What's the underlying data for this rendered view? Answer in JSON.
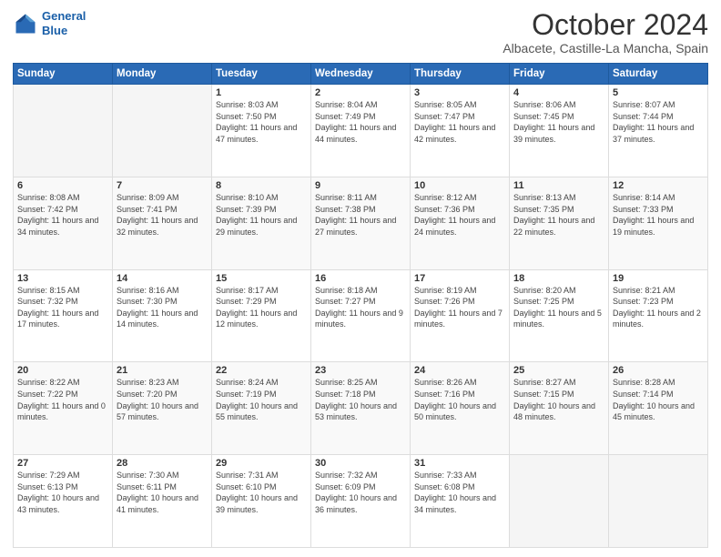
{
  "logo": {
    "line1": "General",
    "line2": "Blue"
  },
  "header": {
    "month": "October 2024",
    "location": "Albacete, Castille-La Mancha, Spain"
  },
  "columns": [
    "Sunday",
    "Monday",
    "Tuesday",
    "Wednesday",
    "Thursday",
    "Friday",
    "Saturday"
  ],
  "weeks": [
    [
      {
        "day": "",
        "sunrise": "",
        "sunset": "",
        "daylight": "",
        "empty": true
      },
      {
        "day": "",
        "sunrise": "",
        "sunset": "",
        "daylight": "",
        "empty": true
      },
      {
        "day": "1",
        "sunrise": "Sunrise: 8:03 AM",
        "sunset": "Sunset: 7:50 PM",
        "daylight": "Daylight: 11 hours and 47 minutes."
      },
      {
        "day": "2",
        "sunrise": "Sunrise: 8:04 AM",
        "sunset": "Sunset: 7:49 PM",
        "daylight": "Daylight: 11 hours and 44 minutes."
      },
      {
        "day": "3",
        "sunrise": "Sunrise: 8:05 AM",
        "sunset": "Sunset: 7:47 PM",
        "daylight": "Daylight: 11 hours and 42 minutes."
      },
      {
        "day": "4",
        "sunrise": "Sunrise: 8:06 AM",
        "sunset": "Sunset: 7:45 PM",
        "daylight": "Daylight: 11 hours and 39 minutes."
      },
      {
        "day": "5",
        "sunrise": "Sunrise: 8:07 AM",
        "sunset": "Sunset: 7:44 PM",
        "daylight": "Daylight: 11 hours and 37 minutes."
      }
    ],
    [
      {
        "day": "6",
        "sunrise": "Sunrise: 8:08 AM",
        "sunset": "Sunset: 7:42 PM",
        "daylight": "Daylight: 11 hours and 34 minutes."
      },
      {
        "day": "7",
        "sunrise": "Sunrise: 8:09 AM",
        "sunset": "Sunset: 7:41 PM",
        "daylight": "Daylight: 11 hours and 32 minutes."
      },
      {
        "day": "8",
        "sunrise": "Sunrise: 8:10 AM",
        "sunset": "Sunset: 7:39 PM",
        "daylight": "Daylight: 11 hours and 29 minutes."
      },
      {
        "day": "9",
        "sunrise": "Sunrise: 8:11 AM",
        "sunset": "Sunset: 7:38 PM",
        "daylight": "Daylight: 11 hours and 27 minutes."
      },
      {
        "day": "10",
        "sunrise": "Sunrise: 8:12 AM",
        "sunset": "Sunset: 7:36 PM",
        "daylight": "Daylight: 11 hours and 24 minutes."
      },
      {
        "day": "11",
        "sunrise": "Sunrise: 8:13 AM",
        "sunset": "Sunset: 7:35 PM",
        "daylight": "Daylight: 11 hours and 22 minutes."
      },
      {
        "day": "12",
        "sunrise": "Sunrise: 8:14 AM",
        "sunset": "Sunset: 7:33 PM",
        "daylight": "Daylight: 11 hours and 19 minutes."
      }
    ],
    [
      {
        "day": "13",
        "sunrise": "Sunrise: 8:15 AM",
        "sunset": "Sunset: 7:32 PM",
        "daylight": "Daylight: 11 hours and 17 minutes."
      },
      {
        "day": "14",
        "sunrise": "Sunrise: 8:16 AM",
        "sunset": "Sunset: 7:30 PM",
        "daylight": "Daylight: 11 hours and 14 minutes."
      },
      {
        "day": "15",
        "sunrise": "Sunrise: 8:17 AM",
        "sunset": "Sunset: 7:29 PM",
        "daylight": "Daylight: 11 hours and 12 minutes."
      },
      {
        "day": "16",
        "sunrise": "Sunrise: 8:18 AM",
        "sunset": "Sunset: 7:27 PM",
        "daylight": "Daylight: 11 hours and 9 minutes."
      },
      {
        "day": "17",
        "sunrise": "Sunrise: 8:19 AM",
        "sunset": "Sunset: 7:26 PM",
        "daylight": "Daylight: 11 hours and 7 minutes."
      },
      {
        "day": "18",
        "sunrise": "Sunrise: 8:20 AM",
        "sunset": "Sunset: 7:25 PM",
        "daylight": "Daylight: 11 hours and 5 minutes."
      },
      {
        "day": "19",
        "sunrise": "Sunrise: 8:21 AM",
        "sunset": "Sunset: 7:23 PM",
        "daylight": "Daylight: 11 hours and 2 minutes."
      }
    ],
    [
      {
        "day": "20",
        "sunrise": "Sunrise: 8:22 AM",
        "sunset": "Sunset: 7:22 PM",
        "daylight": "Daylight: 11 hours and 0 minutes."
      },
      {
        "day": "21",
        "sunrise": "Sunrise: 8:23 AM",
        "sunset": "Sunset: 7:20 PM",
        "daylight": "Daylight: 10 hours and 57 minutes."
      },
      {
        "day": "22",
        "sunrise": "Sunrise: 8:24 AM",
        "sunset": "Sunset: 7:19 PM",
        "daylight": "Daylight: 10 hours and 55 minutes."
      },
      {
        "day": "23",
        "sunrise": "Sunrise: 8:25 AM",
        "sunset": "Sunset: 7:18 PM",
        "daylight": "Daylight: 10 hours and 53 minutes."
      },
      {
        "day": "24",
        "sunrise": "Sunrise: 8:26 AM",
        "sunset": "Sunset: 7:16 PM",
        "daylight": "Daylight: 10 hours and 50 minutes."
      },
      {
        "day": "25",
        "sunrise": "Sunrise: 8:27 AM",
        "sunset": "Sunset: 7:15 PM",
        "daylight": "Daylight: 10 hours and 48 minutes."
      },
      {
        "day": "26",
        "sunrise": "Sunrise: 8:28 AM",
        "sunset": "Sunset: 7:14 PM",
        "daylight": "Daylight: 10 hours and 45 minutes."
      }
    ],
    [
      {
        "day": "27",
        "sunrise": "Sunrise: 7:29 AM",
        "sunset": "Sunset: 6:13 PM",
        "daylight": "Daylight: 10 hours and 43 minutes."
      },
      {
        "day": "28",
        "sunrise": "Sunrise: 7:30 AM",
        "sunset": "Sunset: 6:11 PM",
        "daylight": "Daylight: 10 hours and 41 minutes."
      },
      {
        "day": "29",
        "sunrise": "Sunrise: 7:31 AM",
        "sunset": "Sunset: 6:10 PM",
        "daylight": "Daylight: 10 hours and 39 minutes."
      },
      {
        "day": "30",
        "sunrise": "Sunrise: 7:32 AM",
        "sunset": "Sunset: 6:09 PM",
        "daylight": "Daylight: 10 hours and 36 minutes."
      },
      {
        "day": "31",
        "sunrise": "Sunrise: 7:33 AM",
        "sunset": "Sunset: 6:08 PM",
        "daylight": "Daylight: 10 hours and 34 minutes."
      },
      {
        "day": "",
        "sunrise": "",
        "sunset": "",
        "daylight": "",
        "empty": true
      },
      {
        "day": "",
        "sunrise": "",
        "sunset": "",
        "daylight": "",
        "empty": true
      }
    ]
  ]
}
